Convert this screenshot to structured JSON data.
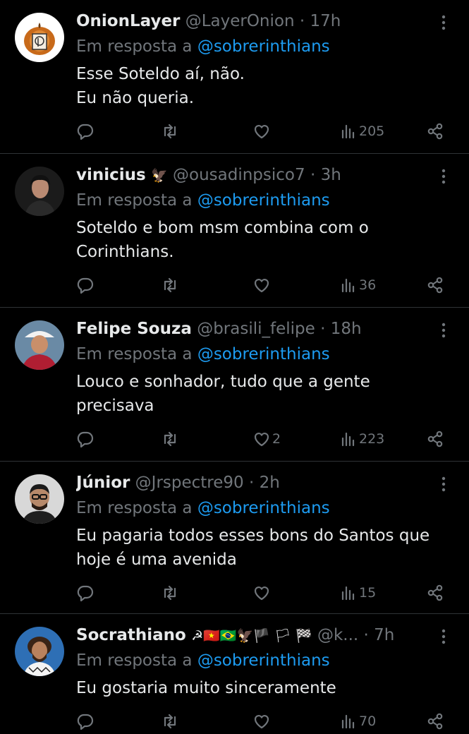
{
  "tweets": [
    {
      "name": "OnionLayer",
      "badge": "",
      "handle": "@LayerOnion",
      "time": "17h",
      "reply_prefix": "Em resposta a",
      "reply_mention": "@sobrerinthians",
      "text": "Esse Soteldo aí, não.\nEu não queria.",
      "likes": "",
      "views": "205"
    },
    {
      "name": "vinicius",
      "badge": "🦅",
      "handle": "@ousadinpsico7",
      "time": "3h",
      "reply_prefix": "Em resposta a",
      "reply_mention": "@sobrerinthians",
      "text": "Soteldo e bom msm combina com o\nCorinthians.",
      "likes": "",
      "views": "36"
    },
    {
      "name": "Felipe Souza",
      "badge": "",
      "handle": "@brasili_felipe",
      "time": "18h",
      "reply_prefix": "Em resposta a",
      "reply_mention": "@sobrerinthians",
      "text": "Louco e sonhador, tudo que a gente\nprecisava",
      "likes": "2",
      "views": "223"
    },
    {
      "name": "Júnior",
      "badge": "",
      "handle": "@Jrspectre90",
      "time": "2h",
      "reply_prefix": "Em resposta a",
      "reply_mention": "@sobrerinthians",
      "text": "Eu pagaria todos esses bons do Santos que\nhoje é uma avenida",
      "likes": "",
      "views": "15"
    },
    {
      "name": "Socrathiano",
      "badge": "☭🇻🇳🇧🇷🦅🏴 🏳 🏁",
      "handle": "@k...",
      "time": "7h",
      "reply_prefix": "Em resposta a",
      "reply_mention": "@sobrerinthians",
      "text": "Eu gostaria muito sinceramente",
      "likes": "",
      "views": "70"
    }
  ],
  "separator": "·",
  "icons": {
    "reply": "reply-icon",
    "retweet": "retweet-icon",
    "like": "heart-icon",
    "views": "views-icon",
    "share": "share-icon",
    "more": "more-vertical-icon"
  },
  "colors": {
    "background": "#000000",
    "text": "#e7e9ea",
    "muted": "#71767b",
    "link": "#1d9bf0",
    "divider": "#2f3336"
  }
}
